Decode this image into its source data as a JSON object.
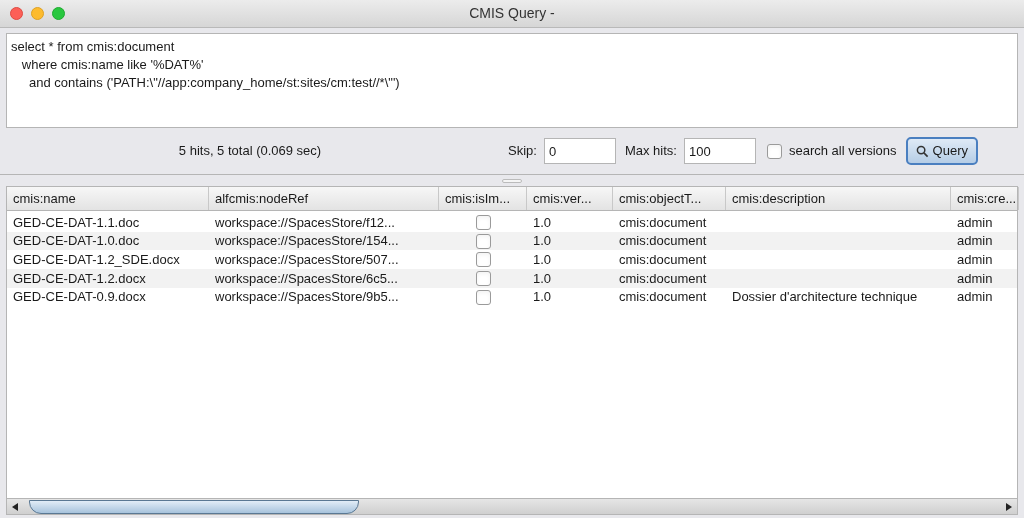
{
  "window": {
    "title": "CMIS Query -"
  },
  "query": {
    "lines": [
      "select * from cmis:document",
      "   where cmis:name like '%DAT%'",
      "     and contains ('PATH:\\\"//app:company_home/st:sites/cm:test//*\\\"')"
    ]
  },
  "status": "5 hits, 5 total (0.069 sec)",
  "skip": {
    "label": "Skip:",
    "value": "0"
  },
  "max_hits": {
    "label": "Max hits:",
    "value": "100"
  },
  "search_all_versions": {
    "label": "search all versions",
    "checked": false
  },
  "query_button": "Query",
  "table": {
    "columns": [
      "cmis:name",
      "alfcmis:nodeRef",
      "cmis:isIm...",
      "cmis:ver...",
      "cmis:objectT...",
      "cmis:description",
      "cmis:cre..."
    ],
    "rows": [
      {
        "name": "GED-CE-DAT-1.1.doc",
        "node_ref": "workspace://SpacesStore/f12...",
        "is_immutable": false,
        "version": "1.0",
        "object_type": "cmis:document",
        "creator": "admin"
      },
      {
        "name": "GED-CE-DAT-1.0.doc",
        "node_ref": "workspace://SpacesStore/154...",
        "is_immutable": false,
        "version": "1.0",
        "object_type": "cmis:document",
        "creator": "admin"
      },
      {
        "name": "GED-CE-DAT-1.2_SDE.docx",
        "node_ref": "workspace://SpacesStore/507...",
        "is_immutable": false,
        "version": "1.0",
        "object_type": "cmis:document",
        "creator": "admin"
      },
      {
        "name": "GED-CE-DAT-1.2.docx",
        "node_ref": "workspace://SpacesStore/6c5...",
        "is_immutable": false,
        "version": "1.0",
        "object_type": "cmis:document",
        "creator": "admin"
      },
      {
        "name": "GED-CE-DAT-0.9.docx",
        "node_ref": "workspace://SpacesStore/9b5...",
        "is_immutable": false,
        "version": "1.0",
        "object_type": "cmis:document",
        "description": "Dossier d'architecture technique",
        "creator": "admin"
      }
    ]
  }
}
